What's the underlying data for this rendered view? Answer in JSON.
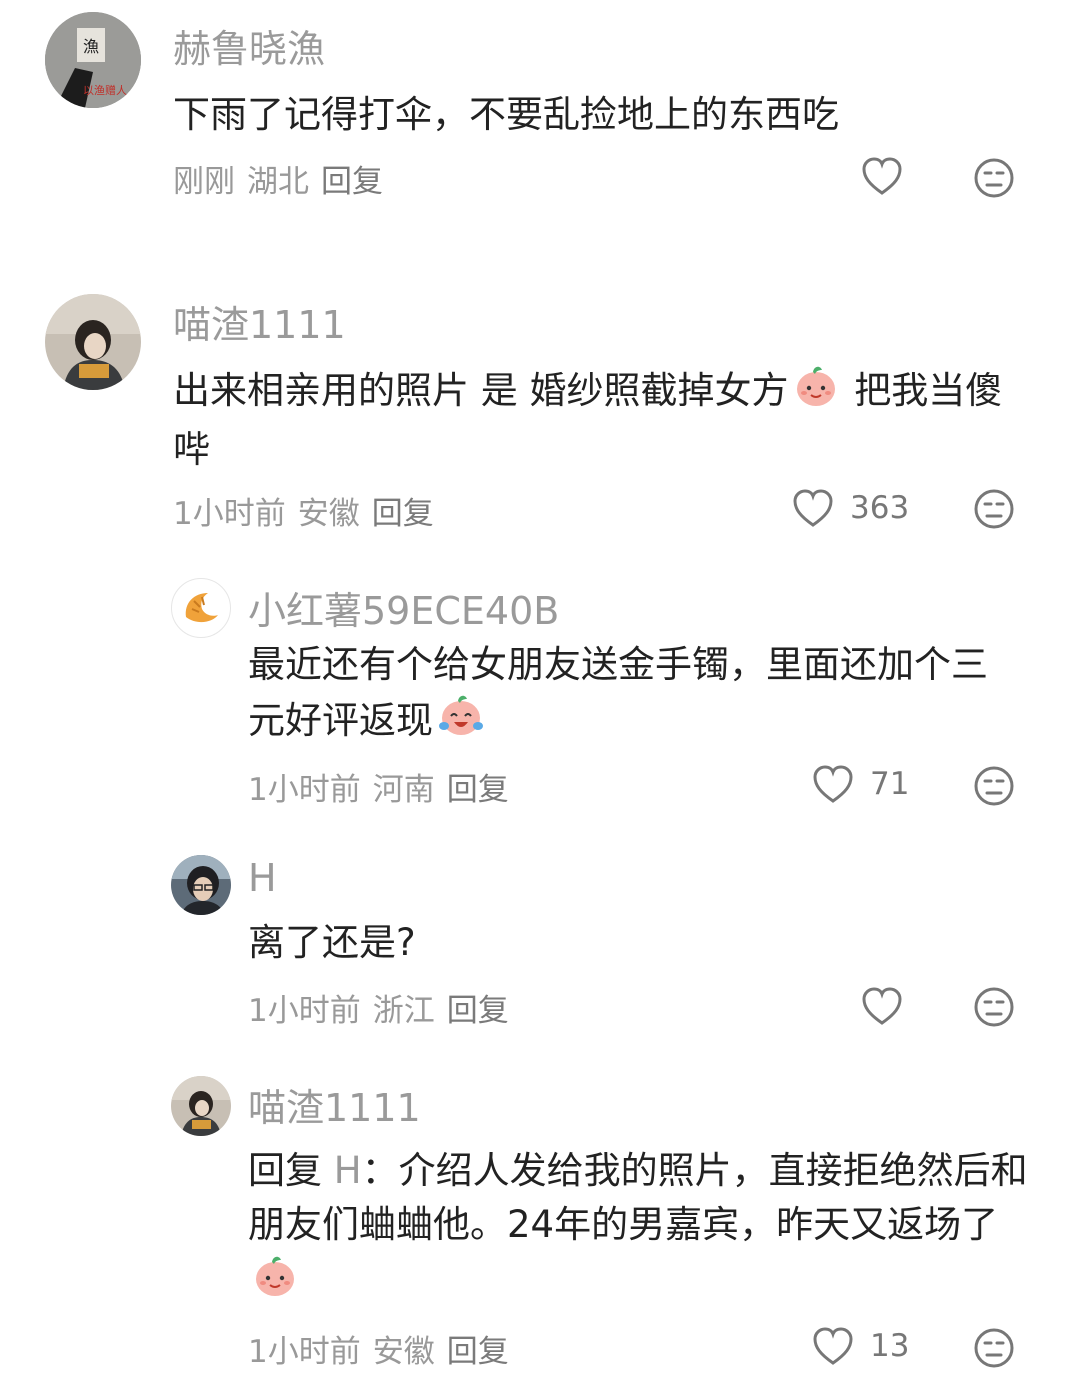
{
  "colors": {
    "username": "#9a9a9a",
    "text": "#222222",
    "meta": "#999999",
    "icon": "#777777"
  },
  "comments": [
    {
      "username": "赫鲁晓漁",
      "text": "下雨了记得打伞，不要乱捡地上的东西吃",
      "time": "刚刚",
      "location": "湖北",
      "reply_label": "回复",
      "likes": "",
      "avatar_text": "漁",
      "avatar_sign": "以渔赠人"
    },
    {
      "username": "喵渣1111",
      "text_before_emoji": "出来相亲用的照片 是 婚纱照截掉女方",
      "emoji": "smiling-peach-emoji",
      "text_after_emoji": " 把我当傻哔",
      "time": "1小时前",
      "location": "安徽",
      "reply_label": "回复",
      "likes": "363"
    },
    {
      "username": "小红薯59ECE40B",
      "text": "最近还有个给女朋友送金手镯，里面还加个三元好评返现",
      "emoji": "crying-laughing-peach-emoji",
      "time": "1小时前",
      "location": "河南",
      "reply_label": "回复",
      "likes": "71"
    },
    {
      "username": "H",
      "text": "离了还是?",
      "time": "1小时前",
      "location": "浙江",
      "reply_label": "回复",
      "likes": ""
    },
    {
      "username": "喵渣1111",
      "reply_prefix": "回复",
      "mention": "H",
      "text": "：介绍人发给我的照片，直接拒绝然后和朋友们蛐蛐他。24年的男嘉宾，昨天又返场了",
      "emoji": "smiling-peach-emoji",
      "time": "1小时前",
      "location": "安徽",
      "reply_label": "回复",
      "likes": "13"
    }
  ]
}
